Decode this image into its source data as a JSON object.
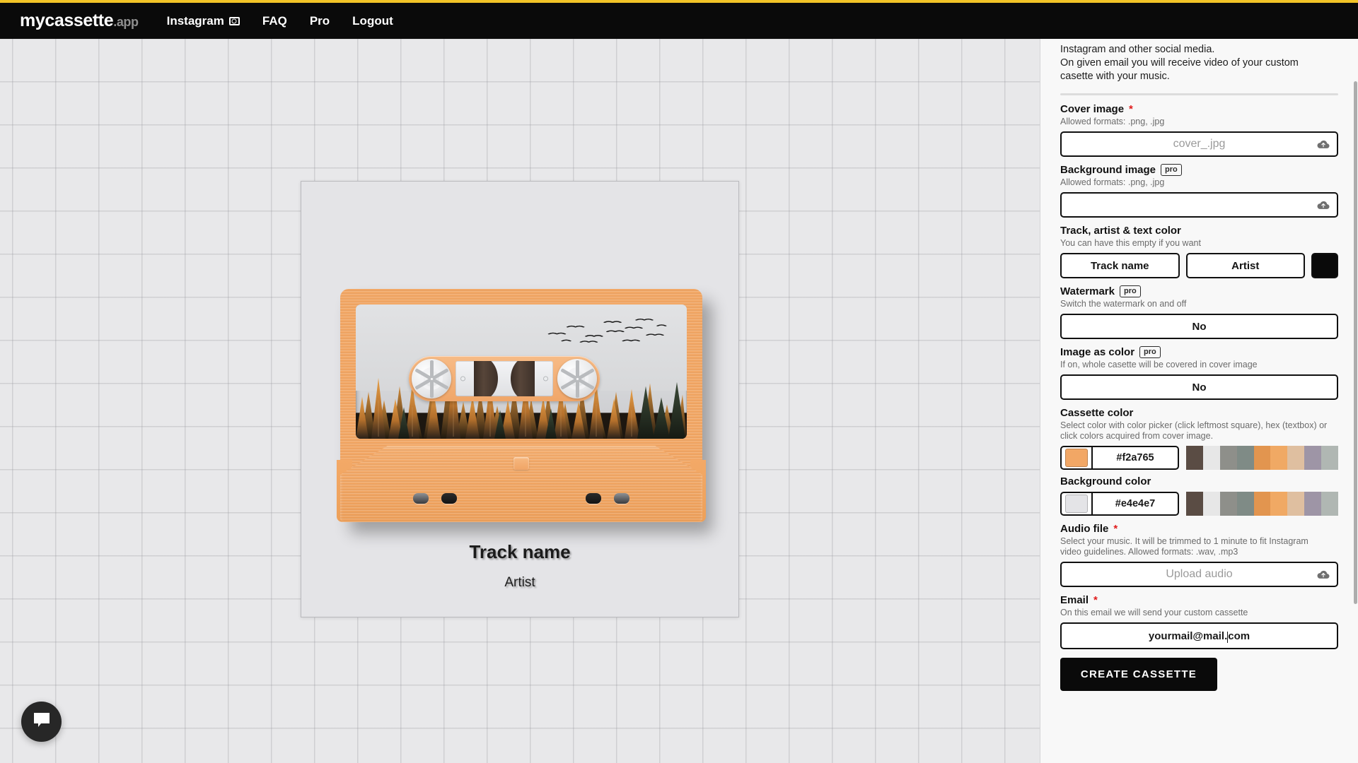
{
  "nav": {
    "brand_main": "mycassette",
    "brand_suffix": ".app",
    "links": [
      {
        "label": "Instagram",
        "icon": "camera-icon"
      },
      {
        "label": "FAQ",
        "icon": ""
      },
      {
        "label": "Pro",
        "icon": ""
      },
      {
        "label": "Logout",
        "icon": ""
      }
    ]
  },
  "preview": {
    "track_name": "Track name",
    "artist": "Artist",
    "cassette_color": "#f2a765",
    "background_color": "#e4e4e7"
  },
  "panel": {
    "intro_line1": "Instagram and other social media.",
    "intro_line2": "On given email you will receive video of your custom",
    "intro_line3": "casette with your music.",
    "cover_image": {
      "label": "Cover image",
      "required": "*",
      "hint": "Allowed formats: .png, .jpg",
      "placeholder": "cover_.jpg",
      "value": ""
    },
    "background_image": {
      "label": "Background image",
      "badge": "pro",
      "hint": "Allowed formats: .png, .jpg",
      "placeholder": "",
      "value": ""
    },
    "text_color": {
      "label": "Track, artist & text color",
      "hint": "You can have this empty if you want",
      "track_placeholder": "Track name",
      "artist_placeholder": "Artist",
      "color_value": "#000000"
    },
    "watermark": {
      "label": "Watermark",
      "badge": "pro",
      "hint": "Switch the watermark on and off",
      "value": "No"
    },
    "image_as_color": {
      "label": "Image as color",
      "badge": "pro",
      "hint": "If on, whole casette will be covered in cover image",
      "value": "No"
    },
    "cassette_color": {
      "label": "Cassette color",
      "hint_line1": "Select color with color picker (click leftmost square), hex (textbox) or",
      "hint_line2": "click colors acquired from cover image.",
      "hex": "#f2a765",
      "chip": "#f2a765",
      "palette": [
        "#5a4c44",
        "#e7e7e7",
        "#8e8f8a",
        "#7f8b86",
        "#e2954f",
        "#f0a964",
        "#dfbfa0",
        "#9e95a6",
        "#b0b7b3"
      ]
    },
    "background_color": {
      "label": "Background color",
      "hex": "#e4e4e7",
      "chip": "#e4e4e7",
      "palette": [
        "#5a4c44",
        "#e7e7e7",
        "#8e8f8a",
        "#7f8b86",
        "#e2954f",
        "#f0a964",
        "#dfbfa0",
        "#9e95a6",
        "#b0b7b3"
      ]
    },
    "audio_file": {
      "label": "Audio file",
      "required": "*",
      "hint_line1": "Select your music. It will be trimmed to 1 minute to fit Instagram",
      "hint_line2": "video guidelines. Allowed formats: .wav, .mp3",
      "placeholder": "Upload audio",
      "value": ""
    },
    "email": {
      "label": "Email",
      "required": "*",
      "hint": "On this email we will send your custom cassette",
      "value_before_caret": "yourmail@mail.",
      "value_after_caret": "com"
    },
    "submit_label": "CREATE CASSETTE"
  },
  "chat": {
    "icon": "chat-bubble-icon"
  }
}
